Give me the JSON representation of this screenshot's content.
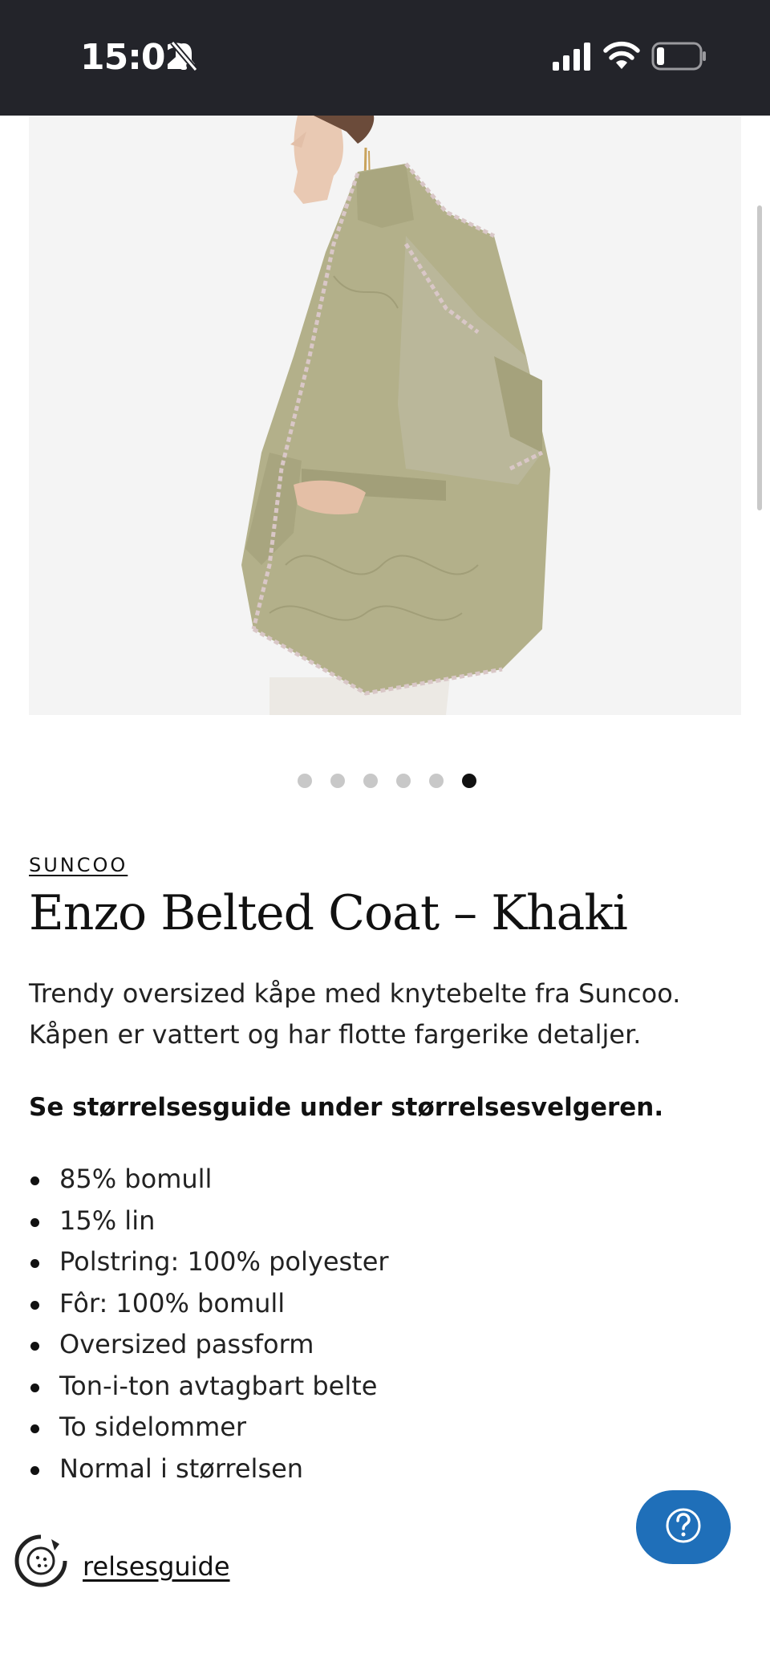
{
  "status_bar": {
    "time": "15:02",
    "icons": [
      "bell-slash-icon",
      "signal-icon",
      "wifi-icon",
      "battery-icon"
    ]
  },
  "product": {
    "image_carousel": {
      "total": 6,
      "active_index": 5
    },
    "brand": "SUNCOO",
    "title": "Enzo Belted Coat – Khaki",
    "description": "Trendy oversized kåpe med knytebelte fra Suncoo. Kåpen er vattert og har flotte fargerike detaljer.",
    "size_note": "Se størrelsesguide under størrelsesvelgeren.",
    "features": [
      "85% bomull",
      "15% lin",
      "Polstring: 100% polyester",
      "Fôr: 100% bomull",
      "Oversized passform",
      "Ton-i-ton avtagbart belte",
      "To sidelommer",
      "Normal i størrelsen"
    ]
  },
  "footer": {
    "size_guide_link": "relsesguide",
    "help_icon": "question-mark-icon",
    "cookie_icon": "cookie-settings-icon"
  },
  "colors": {
    "status_bar_bg": "#23242a",
    "help_button": "#1f6fb9",
    "active_dot": "#111111",
    "inactive_dot": "#c8c8c8",
    "coat": "#b3b08a"
  }
}
